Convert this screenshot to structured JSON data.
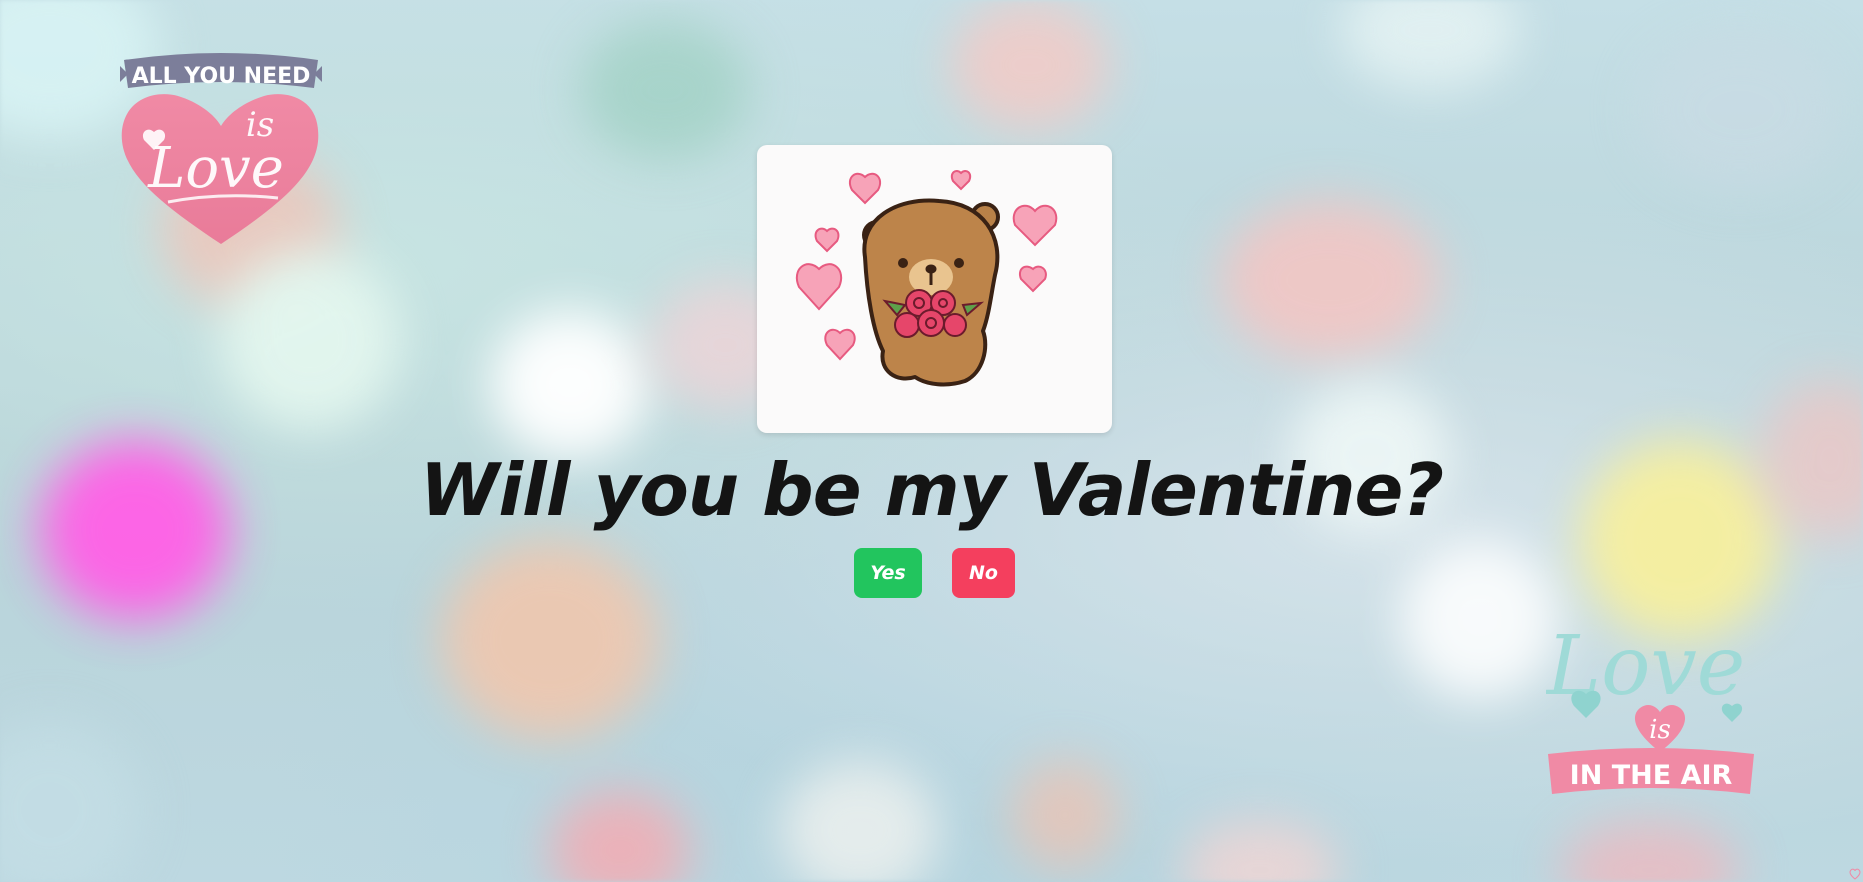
{
  "page": {
    "question": "Will you be my Valentine?",
    "buttons": {
      "yes_label": "Yes",
      "no_label": "No"
    }
  },
  "stickers": {
    "top_left": {
      "line1": "ALL YOU NEED",
      "line2": "is",
      "line3": "Love"
    },
    "bottom_right": {
      "line1": "Love",
      "line2": "is",
      "line3": "IN THE AIR"
    }
  },
  "image": {
    "icon": "teddy-bear-with-roses-and-hearts"
  },
  "colors": {
    "yes": "#22c55e",
    "no": "#f43f5e",
    "headline": "#141414",
    "card": "#fbfafa"
  }
}
